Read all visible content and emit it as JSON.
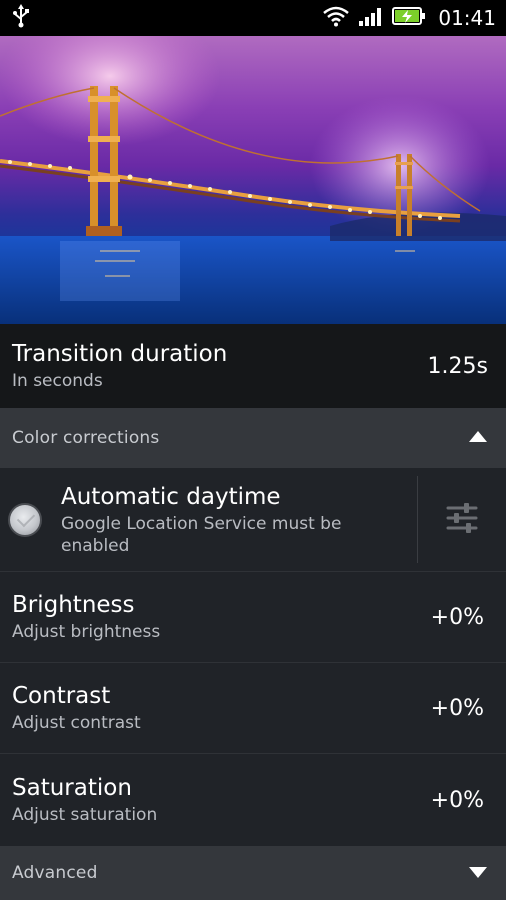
{
  "status_bar": {
    "time": "01:41",
    "icons": [
      "usb-icon",
      "wifi-icon",
      "signal-icon",
      "battery-charging-icon"
    ]
  },
  "transition": {
    "title": "Transition duration",
    "subtitle": "In seconds",
    "value": "1.25s"
  },
  "color_corrections": {
    "header": "Color corrections",
    "expanded": true,
    "automatic_daytime": {
      "title": "Automatic daytime",
      "subtitle": "Google Location Service must be enabled",
      "checked": false
    },
    "brightness": {
      "title": "Brightness",
      "subtitle": "Adjust brightness",
      "value": "+0%"
    },
    "contrast": {
      "title": "Contrast",
      "subtitle": "Adjust contrast",
      "value": "+0%"
    },
    "saturation": {
      "title": "Saturation",
      "subtitle": "Adjust saturation",
      "value": "+0%"
    }
  },
  "advanced": {
    "header": "Advanced",
    "expanded": false
  },
  "colors": {
    "background": "#1b1d21",
    "section_header": "#34373c",
    "secondary_text": "#b9bcc2"
  }
}
